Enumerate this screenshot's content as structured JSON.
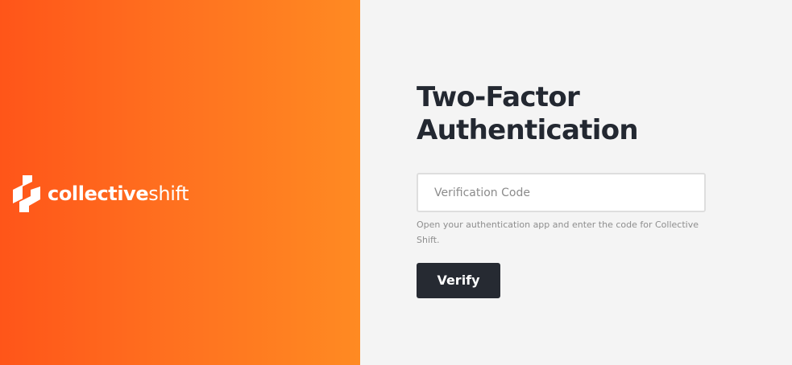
{
  "brand": {
    "logo_icon": "collective-shift-logo-icon",
    "logo_bold": "collective",
    "logo_light": "shift"
  },
  "auth": {
    "title": "Two-Factor Authentication",
    "verification_code_placeholder": "Verification Code",
    "verification_code_value": "",
    "help_text": "Open your authentication app and enter the code for Collective Shift.",
    "verify_label": "Verify"
  },
  "colors": {
    "brand_gradient_start": "#ff5519",
    "brand_gradient_end": "#ff8a22",
    "panel_background": "#f4f4f4",
    "title_text": "#232831",
    "button_background": "#262a32",
    "button_text": "#ffffff",
    "help_text": "#8e8e8e"
  }
}
